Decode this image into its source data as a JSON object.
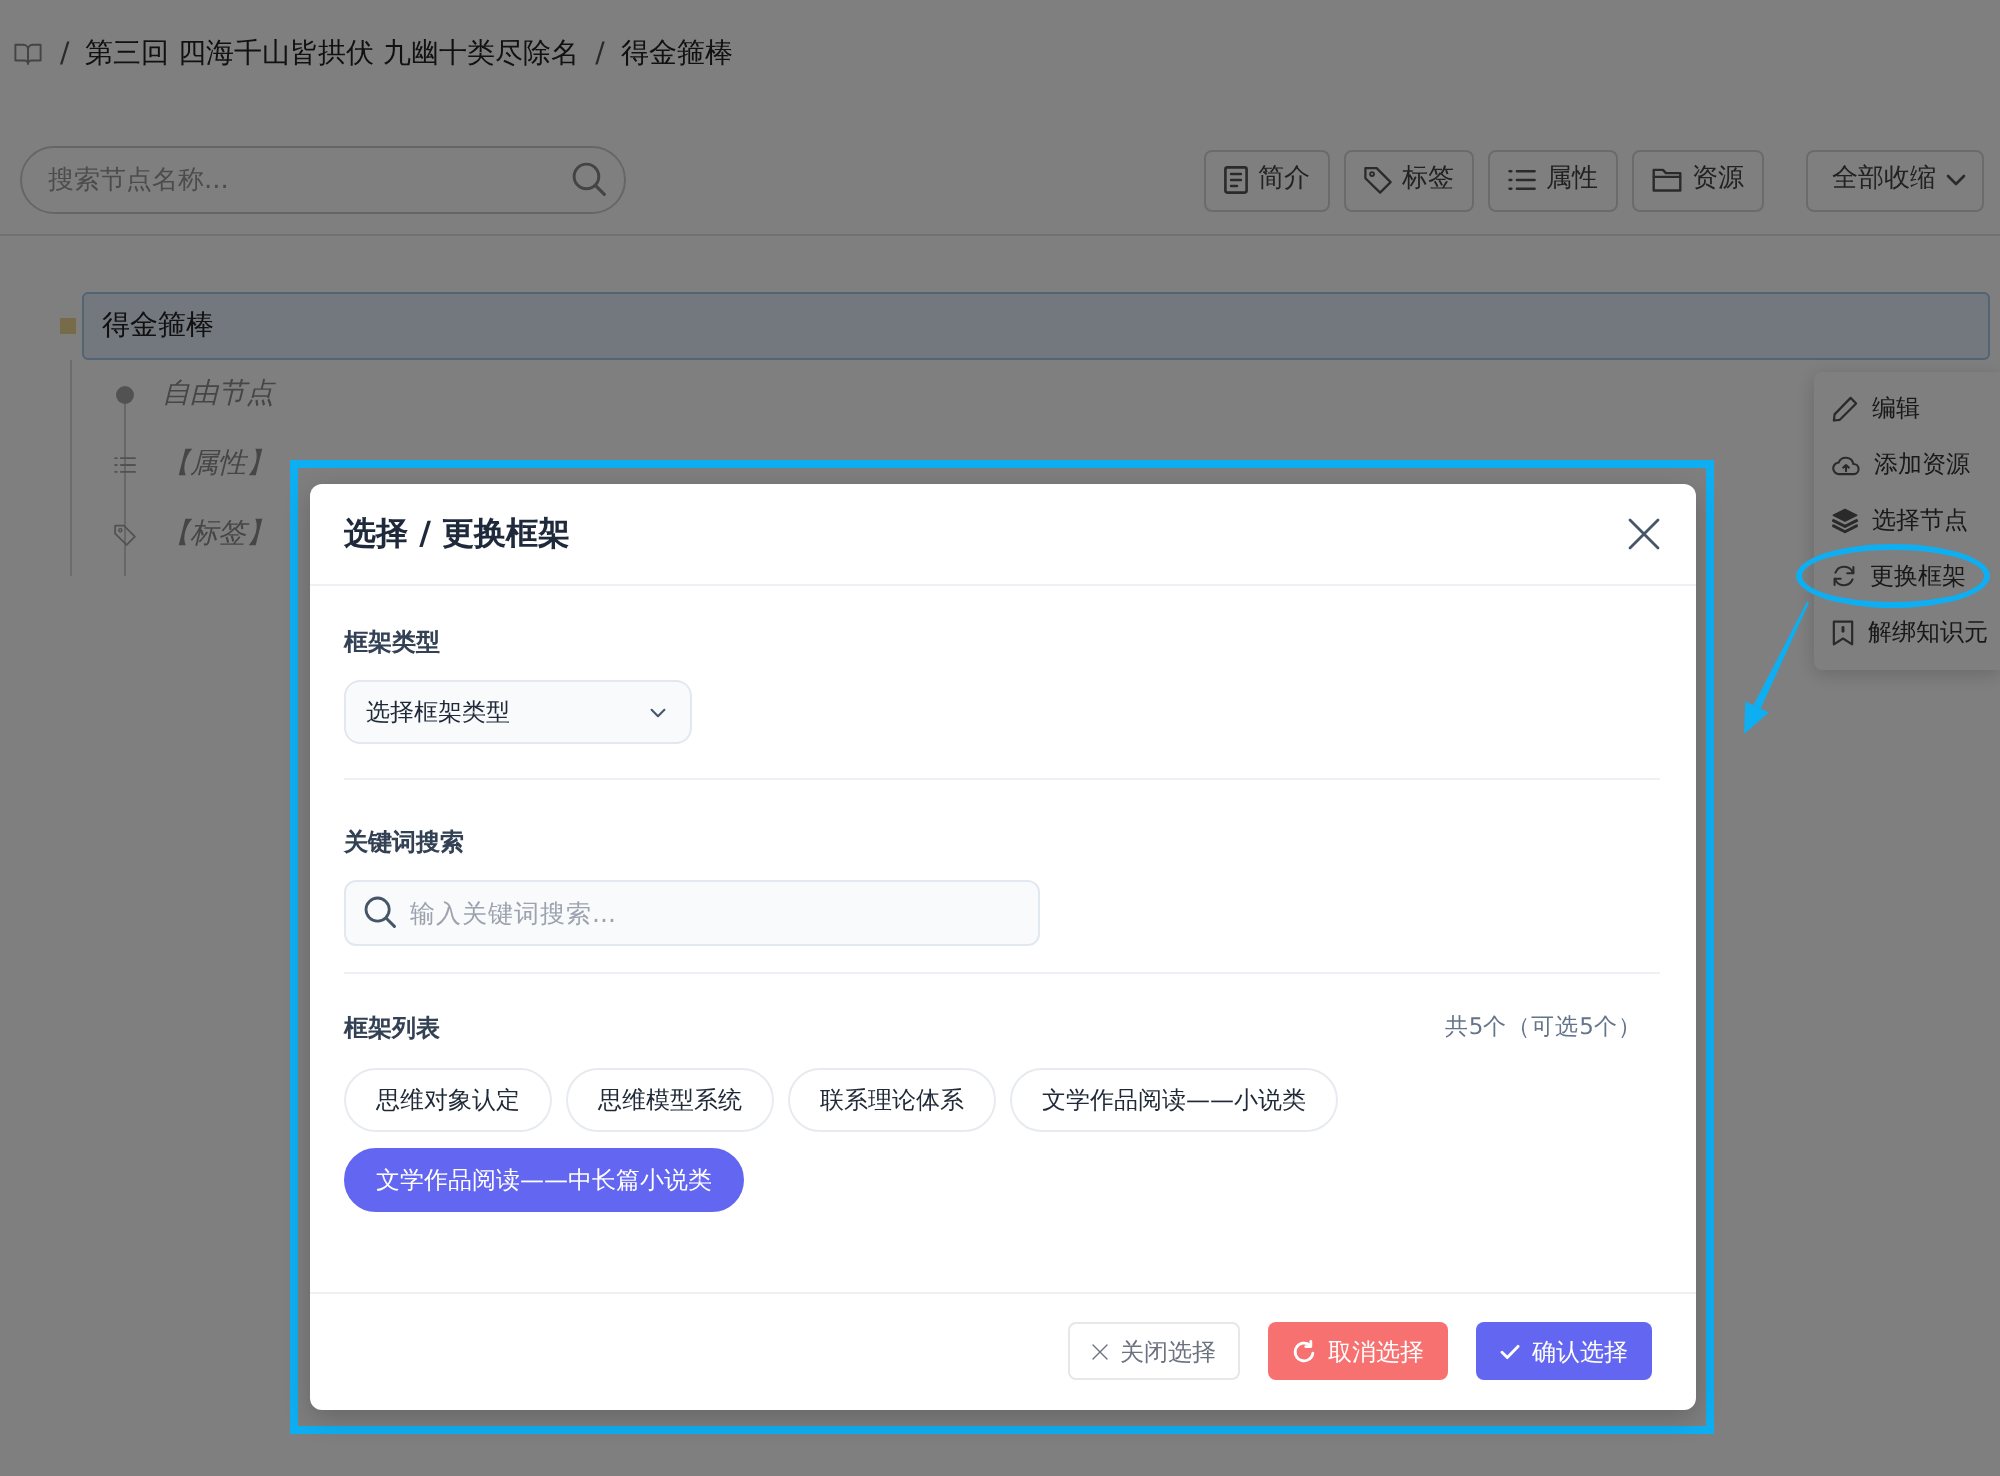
{
  "breadcrumb": {
    "items": [
      {
        "separator": "/",
        "label": "第三回 四海千山皆拱伏 九幽十类尽除名"
      },
      {
        "separator": "/",
        "label": "得金箍棒"
      }
    ]
  },
  "search": {
    "placeholder": "搜索节点名称..."
  },
  "toolbar": {
    "buttons": [
      {
        "kind": "intro",
        "label": "简介"
      },
      {
        "kind": "tags",
        "label": "标签"
      },
      {
        "kind": "attributes",
        "label": "属性"
      },
      {
        "kind": "resources",
        "label": "资源"
      }
    ],
    "dropdown": {
      "label": "全部收缩"
    }
  },
  "tree": {
    "nodes": [
      {
        "label": "得金箍棒",
        "selected": true,
        "children": [
          {
            "kind": "node",
            "label": "自由节点",
            "selected": false
          },
          {
            "kind": "attribute",
            "label": "【属性】",
            "selected": false
          },
          {
            "kind": "tag",
            "label": "【标签】",
            "selected": false
          }
        ]
      }
    ]
  },
  "context_menu": {
    "items": [
      {
        "kind": "edit",
        "label": "编辑",
        "highlighted": false
      },
      {
        "kind": "resource",
        "label": "添加资源",
        "highlighted": false
      },
      {
        "kind": "select",
        "label": "选择节点",
        "highlighted": false
      },
      {
        "kind": "replace",
        "label": "更换框架",
        "highlighted": true
      },
      {
        "kind": "unbind",
        "label": "解绑知识元",
        "highlighted": false
      }
    ]
  },
  "modal": {
    "title": "选择 / 更换框架",
    "highlighted": true,
    "type_field": {
      "label": "框架类型",
      "value": "选择框架类型"
    },
    "keyword_search": {
      "label": "关键词搜索",
      "placeholder": "输入关键词搜索..."
    },
    "frame_list": {
      "label": "框架列表",
      "count": "共5个（可选5个）",
      "items": [
        {
          "label": "思维对象认定",
          "selected": false
        },
        {
          "label": "思维模型系统",
          "selected": false
        },
        {
          "label": "联系理论体系",
          "selected": false
        },
        {
          "label": "文学作品阅读——小说类",
          "selected": false
        },
        {
          "label": "文学作品阅读——中长篇小说类",
          "selected": true
        }
      ]
    },
    "buttons": [
      {
        "kind": "close",
        "label": "关闭选择"
      },
      {
        "kind": "reset",
        "label": "取消选择"
      },
      {
        "kind": "confirm",
        "label": "确认选择"
      }
    ]
  }
}
